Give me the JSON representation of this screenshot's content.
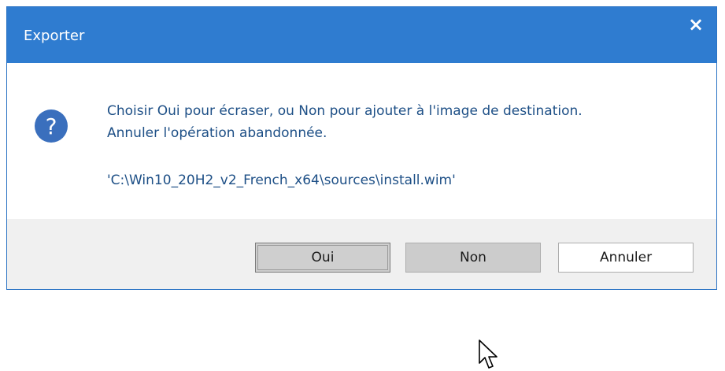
{
  "dialog": {
    "title": "Exporter",
    "close_glyph": "×",
    "message_line1": "Choisir Oui pour écraser, ou Non pour ajouter à l'image de destination.",
    "message_line2": "Annuler l'opération abandonnée.",
    "path": "'C:\\Win10_20H2_v2_French_x64\\sources\\install.wim'",
    "icon": "question-icon",
    "icon_glyph": "?",
    "buttons": {
      "yes": "Oui",
      "no": "Non",
      "cancel": "Annuler"
    }
  },
  "colors": {
    "titlebar": "#2f7cd0",
    "icon_fill": "#3a6fbd",
    "message_text": "#1d4f86",
    "footer": "#f0f0f0"
  }
}
